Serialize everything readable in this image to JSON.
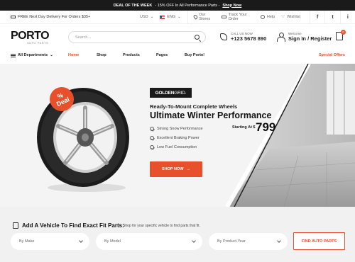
{
  "promo": {
    "lead": "DEAL OF THE WEEK",
    "text": "- 15% OFF In All Performance Parts -",
    "link": "Shop Now"
  },
  "topbar": {
    "shipping": "FREE Next Day Delivery For Orders $35+",
    "currency": "USD",
    "language": "ENG",
    "links": [
      "Our Stores",
      "Track Your Order",
      "Help",
      "Wishlist"
    ],
    "social": [
      "f",
      "t",
      "i"
    ]
  },
  "header": {
    "logo_text": "PORTO",
    "logo_sub": "AUTO PARTS",
    "search_placeholder": "Search...",
    "call_label": "CALL US NOW",
    "phone": "+123 5678 890",
    "welcome": "Welcome",
    "signin": "Sign In / Register",
    "cart_count": "0"
  },
  "nav": {
    "departments": "All Departments",
    "items": [
      "Home",
      "Shop",
      "Products",
      "Pages",
      "Buy Porto!"
    ],
    "special": "Special Offers"
  },
  "hero": {
    "badge_percent": "%",
    "badge_text": "Deal",
    "brand_bold": "GOLDEN",
    "brand_light": "GRID.",
    "subtitle": "Ready-To-Mount Complete Wheels",
    "title": "Ultimate Winter Performance",
    "features": [
      "Strong Snow Performance",
      "Excellent Braking Power",
      "Low Fuel Consumption"
    ],
    "starting": "Starting At $",
    "price": "799",
    "button": "SHOP NOW",
    "button_arrow": "→"
  },
  "finder": {
    "title": "Add A Vehicle To Find Exact Fit Parts:",
    "subtitle": "Shop for your specific vehicle to find parts that fit.",
    "selects": [
      "By Make",
      "By Model",
      "By Product-Year"
    ],
    "button": "FIND AUTO PARTS"
  }
}
